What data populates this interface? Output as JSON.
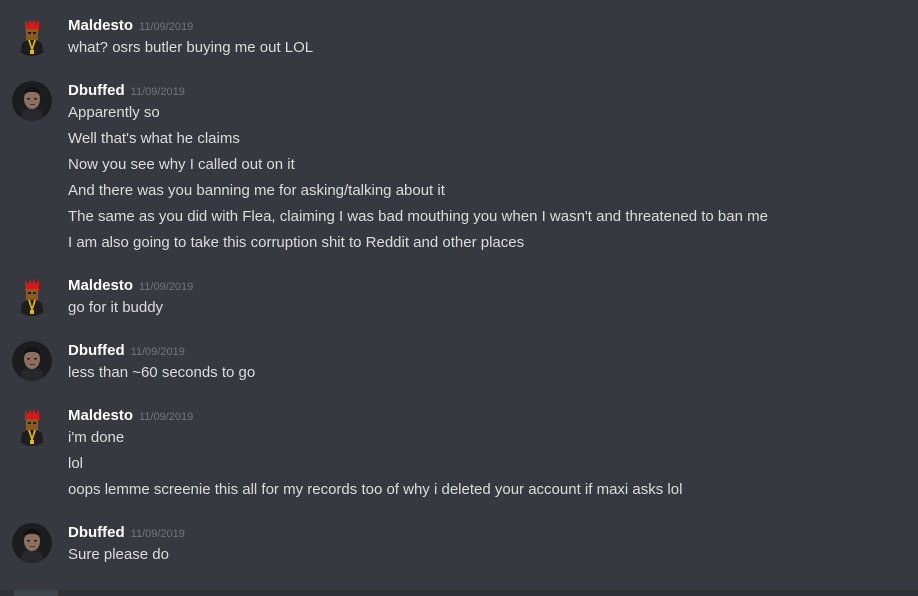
{
  "groups": [
    {
      "author": "Maldesto",
      "avatar_icon": "red-hair-character-avatar",
      "timestamp": "11/09/2019",
      "lines": [
        "what? osrs butler buying me out LOL"
      ]
    },
    {
      "author": "Dbuffed",
      "avatar_icon": "dark-portrait-avatar",
      "timestamp": "11/09/2019",
      "lines": [
        "Apparently so",
        "Well that's what he claims",
        "Now you see why I called out on it",
        "And there was you banning me for asking/talking about it",
        "The same as you did with Flea, claiming I was bad mouthing you when I wasn't and threatened to ban me",
        "I am also going to take this corruption shit to Reddit and other places"
      ]
    },
    {
      "author": "Maldesto",
      "avatar_icon": "red-hair-character-avatar",
      "timestamp": "11/09/2019",
      "lines": [
        "go for it buddy"
      ]
    },
    {
      "author": "Dbuffed",
      "avatar_icon": "dark-portrait-avatar",
      "timestamp": "11/09/2019",
      "lines": [
        "less than ~60 seconds to go"
      ]
    },
    {
      "author": "Maldesto",
      "avatar_icon": "red-hair-character-avatar",
      "timestamp": "11/09/2019",
      "lines": [
        "i'm done",
        "lol",
        "oops lemme screenie this all for my records too of why i deleted your account if maxi asks lol"
      ]
    },
    {
      "author": "Dbuffed",
      "avatar_icon": "dark-portrait-avatar",
      "timestamp": "11/09/2019",
      "lines": [
        "Sure please do"
      ]
    }
  ],
  "colors": {
    "background": "#36393f",
    "username": "#ffffff",
    "timestamp": "#72767d",
    "message_text": "#dcddde"
  }
}
